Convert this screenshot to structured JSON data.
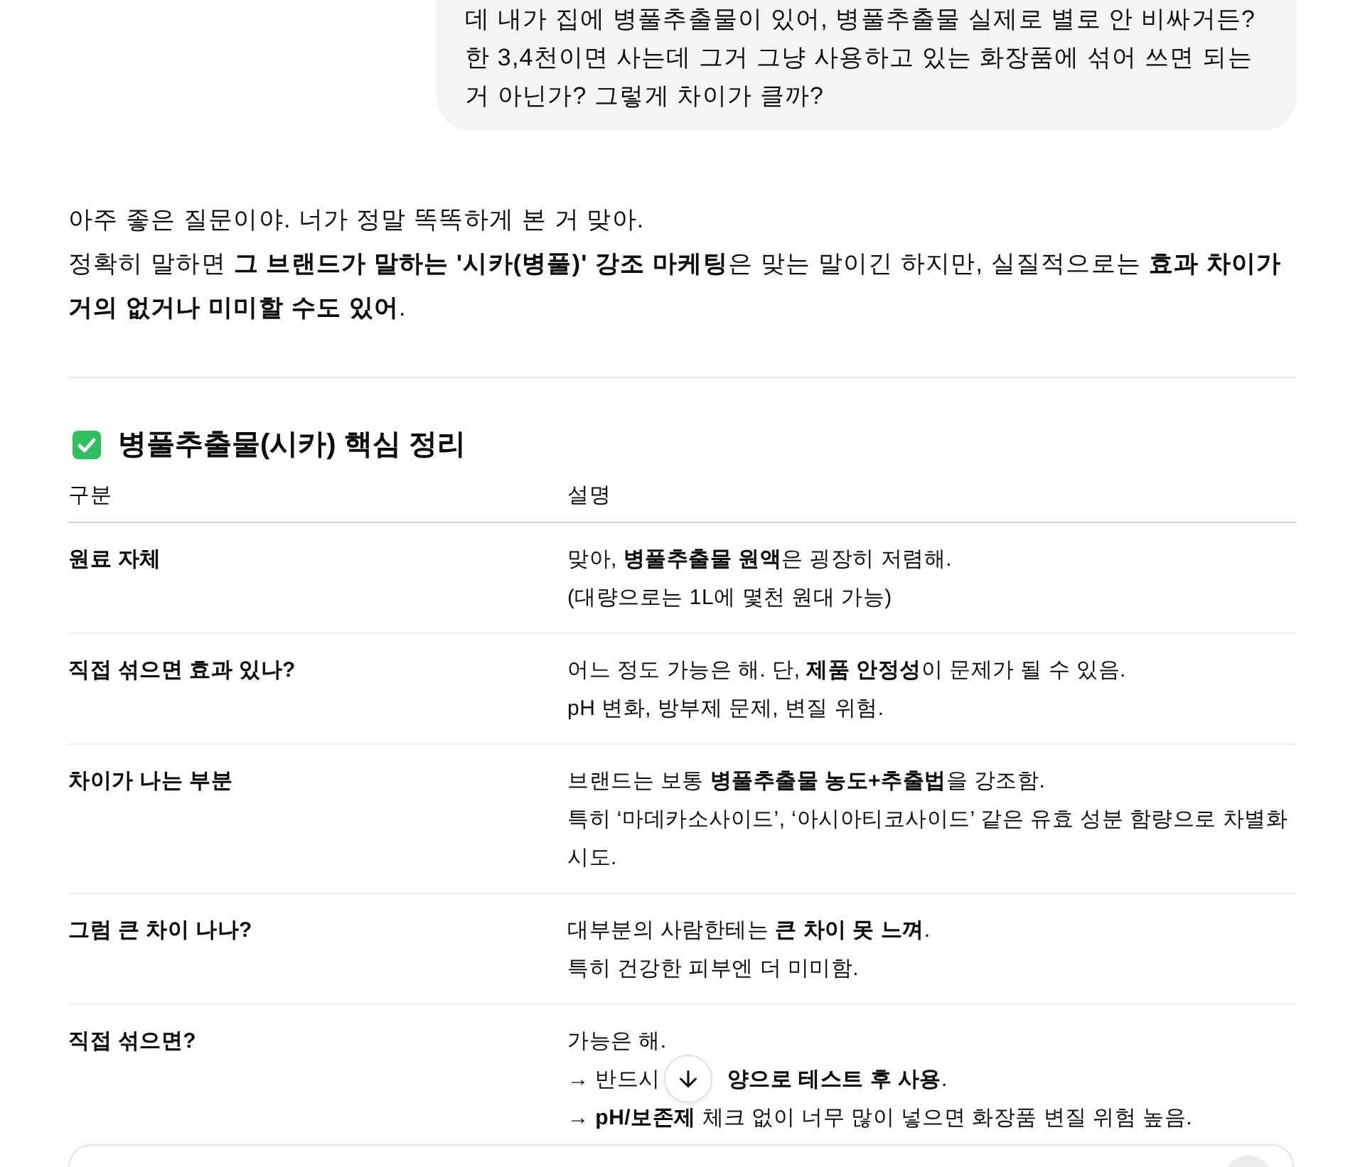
{
  "user_message": {
    "text": "데 내가 집에 병풀추출물이 있어, 병풀추출물 실제로 별로 안 비싸거든? 한 3,4천이면 사는데 그거 그냥 사용하고 있는 화장품에 섞어 쓰면 되는 거 아닌가? 그렇게 차이가 클까?"
  },
  "answer": {
    "paragraphs": [
      "아주 좋은 질문이야. 너가 정말 똑똑하게 본 거 맞아.",
      "정확히 말하면 **그 브랜드가 말하는 '시카(병풀)' 강조 마케팅**은 맞는 말이긴 하지만, 실질적으로는 **효과 차이가 거의 없거나 미미할 수도 있어**."
    ]
  },
  "section": {
    "title": "병풀추출물(시카) 핵심 정리"
  },
  "table": {
    "columns": [
      "구분",
      "설명"
    ],
    "rows": [
      {
        "label": "원료 자체",
        "lines": [
          {
            "kind": "text",
            "text": "맞아, **병풀추출물 원액**은 굉장히 저렴해."
          },
          {
            "kind": "text",
            "text": "(대량으로는 1L에 몇천 원대 가능)"
          }
        ]
      },
      {
        "label": "직접 섞으면 효과 있나?",
        "lines": [
          {
            "kind": "text",
            "text": "어느 정도 가능은 해. 단, **제품 안정성**이 문제가 될 수 있음."
          },
          {
            "kind": "text",
            "text": "pH 변화, 방부제 문제, 변질 위험."
          }
        ]
      },
      {
        "label": "차이가 나는 부분",
        "lines": [
          {
            "kind": "text",
            "text": "브랜드는 보통 **병풀추출물 농도+추출법**을 강조함."
          },
          {
            "kind": "text",
            "text": "특히 ‘마데카소사이드’, ‘아시아티코사이드’ 같은 유효 성분 함량으로 차별화 시도."
          }
        ]
      },
      {
        "label": "그럼 큰 차이 나나?",
        "lines": [
          {
            "kind": "text",
            "text": "대부분의 사람한테는 **큰 차이 못 느껴**."
          },
          {
            "kind": "text",
            "text": "특히 건강한 피부엔 더 미미함."
          }
        ]
      },
      {
        "label": "직접 섞으면?",
        "lines": [
          {
            "kind": "text",
            "text": "가능은 해."
          },
          {
            "kind": "covered",
            "before": "→ 반드시",
            "after": "**양으로 테스트 후 사용**."
          },
          {
            "kind": "text",
            "text": "→ **pH/보존제** 체크 없이 너무 많이 넣으면 화장품 변질 위험 높음."
          }
        ]
      }
    ]
  }
}
